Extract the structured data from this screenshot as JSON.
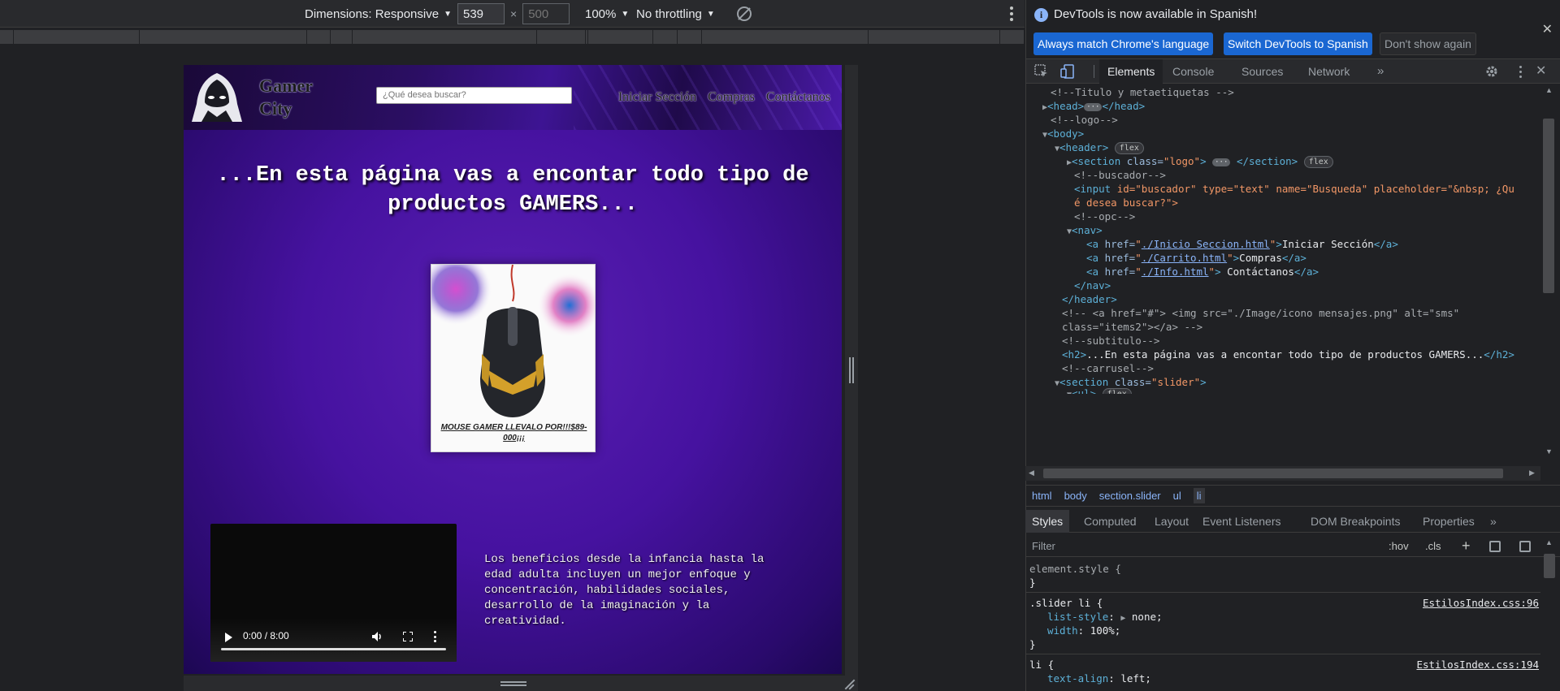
{
  "device_toolbar": {
    "dimensions_label": "Dimensions: Responsive",
    "width_value": "539",
    "height_placeholder": "500",
    "times": "×",
    "zoom": "100%",
    "throttling": "No throttling"
  },
  "website": {
    "logo_text": "Gamer City",
    "search_placeholder": "¿Qué desea buscar?",
    "nav": [
      "Iniciar Sección",
      "Compras",
      "Contáctanos"
    ],
    "subtitle": "...En esta página vas a encontar todo tipo de productos GAMERS...",
    "product_caption": "MOUSE GAMER LLEVALO POR!!!$89-000¡¡¡",
    "video_time": "0:00 / 8:00",
    "video_progress": 0,
    "benefits_text": "Los beneficios desde la infancia hasta la edad adulta incluyen un mejor enfoque y concentración, habilidades sociales, desarrollo de la imaginación y la creatividad."
  },
  "devtools": {
    "infobar": {
      "message": "DevTools is now available in Spanish!",
      "btn_match": "Always match Chrome's language",
      "btn_switch": "Switch DevTools to Spanish",
      "btn_dismiss": "Don't show again"
    },
    "tabs": [
      "Elements",
      "Console",
      "Sources",
      "Network"
    ],
    "dom": {
      "comment_titulo": "<!--Titulo y metaetiquetas -->",
      "head_open": "<head>",
      "head_close": "</head>",
      "comment_logo": "<!--logo-->",
      "body": "<body>",
      "header": "<header>",
      "flex_badge": "flex",
      "section_logo_open": "<section ",
      "section_logo_attr": "class=",
      "section_logo_val": "\"logo\"",
      "section_close": "</section>",
      "comment_buscador": "<!--buscador-->",
      "input_line1_tag": "<input ",
      "input_line1_attrs": "id=\"buscador\" type=\"text\" name=\"Busqueda\" placeholder=\"&nbsp; ¿Qu",
      "input_line2": "é desea buscar?\">",
      "comment_opc": "<!--opc-->",
      "nav_open": "<nav>",
      "link1_href": "./Inicio Seccion.html",
      "link1_text": "Iniciar Sección",
      "link2_href": "./Carrito.html",
      "link2_text": "Compras",
      "link3_href": "./Info.html",
      "link3_text": " Contáctanos",
      "nav_close": "</nav>",
      "header_close": "</header>",
      "comment_a_line1": "<!-- <a href=\"#\"> <img src=\"./Image/icono mensajes.png\" alt=\"sms\"",
      "comment_a_line2": "class=\"items2\"></a> -->",
      "comment_subtitulo": "<!--subtitulo-->",
      "h2_text": "...En esta página vas a encontar todo tipo de productos GAMERS...",
      "comment_carrusel": "<!--carrusel-->",
      "section_slider_val": "\"slider\"",
      "ul_partial": "<ul>"
    },
    "breadcrumbs": [
      "html",
      "body",
      "section.slider",
      "ul",
      "li"
    ],
    "styles_tabs": [
      "Styles",
      "Computed",
      "Layout",
      "Event Listeners",
      "DOM Breakpoints",
      "Properties"
    ],
    "filter_placeholder": "Filter",
    "hov": ":hov",
    "cls": ".cls",
    "rules": {
      "element_style": "element.style {",
      "close_brace": "}",
      "slider_selector": ".slider li {",
      "slider_src": "EstilosIndex.css:96",
      "prop_list_style": "list-style",
      "val_list_style": "none;",
      "prop_width": "width",
      "val_width": "100%;",
      "li_selector": "li {",
      "li_src": "EstilosIndex.css:194",
      "prop_text_align": "text-align",
      "val_text_align": "left;"
    }
  }
}
